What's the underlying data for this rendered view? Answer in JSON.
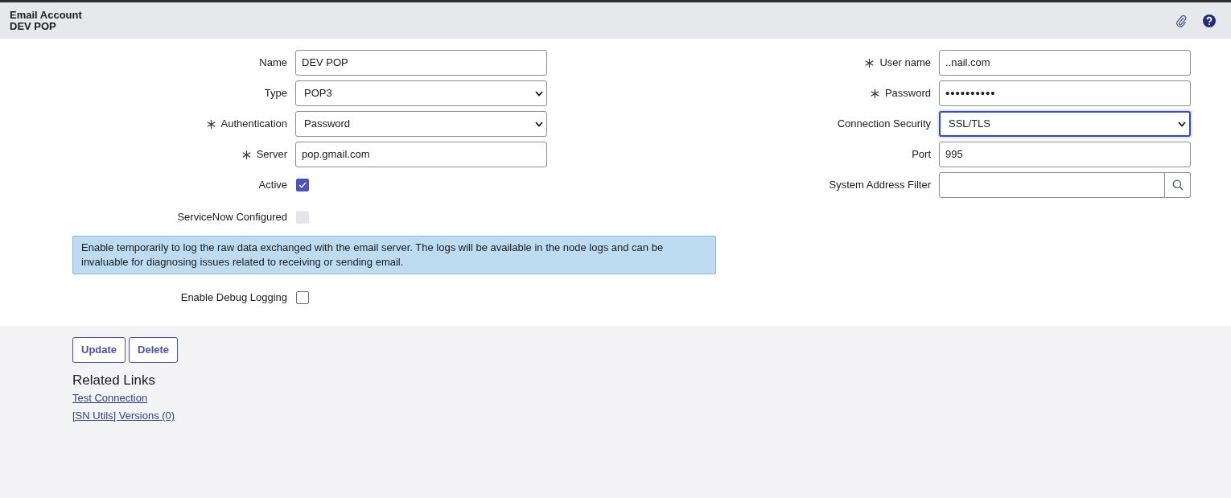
{
  "header": {
    "title": "Email Account",
    "subtitle": "DEV POP"
  },
  "left_fields": [
    {
      "kind": "text",
      "label": "Name",
      "required": false,
      "value": "DEV POP"
    },
    {
      "kind": "select",
      "label": "Type",
      "required": false,
      "value": "POP3"
    },
    {
      "kind": "select",
      "label": "Authentication",
      "required": true,
      "value": "Password"
    },
    {
      "kind": "text",
      "label": "Server",
      "required": true,
      "value": "pop.gmail.com"
    },
    {
      "kind": "checkbox",
      "label": "Active",
      "checked": true,
      "disabled": false
    },
    {
      "kind": "checkbox",
      "label": "ServiceNow Configured",
      "checked": false,
      "disabled": true
    }
  ],
  "right_fields": [
    {
      "kind": "text",
      "label": "User name",
      "required": true,
      "value": "..nail.com"
    },
    {
      "kind": "password",
      "label": "Password",
      "required": true,
      "value": "••••••••••"
    },
    {
      "kind": "select",
      "label": "Connection Security",
      "required": false,
      "value": "SSL/TLS",
      "focused": true
    },
    {
      "kind": "text",
      "label": "Port",
      "required": false,
      "value": "995"
    },
    {
      "kind": "lookup",
      "label": "System Address Filter",
      "required": false
    }
  ],
  "info_message": "Enable temporarily to log the raw data exchanged with the email server. The logs will be available in the node logs and can be invaluable for diagnosing issues related to receiving or sending email.",
  "debug_field": {
    "kind": "checkbox",
    "label": "Enable Debug Logging",
    "checked": false,
    "disabled": false
  },
  "buttons": [
    "Update",
    "Delete"
  ],
  "related_links": {
    "title": "Related Links",
    "links": [
      "Test Connection",
      "[SN Utils] Versions (0)"
    ]
  }
}
